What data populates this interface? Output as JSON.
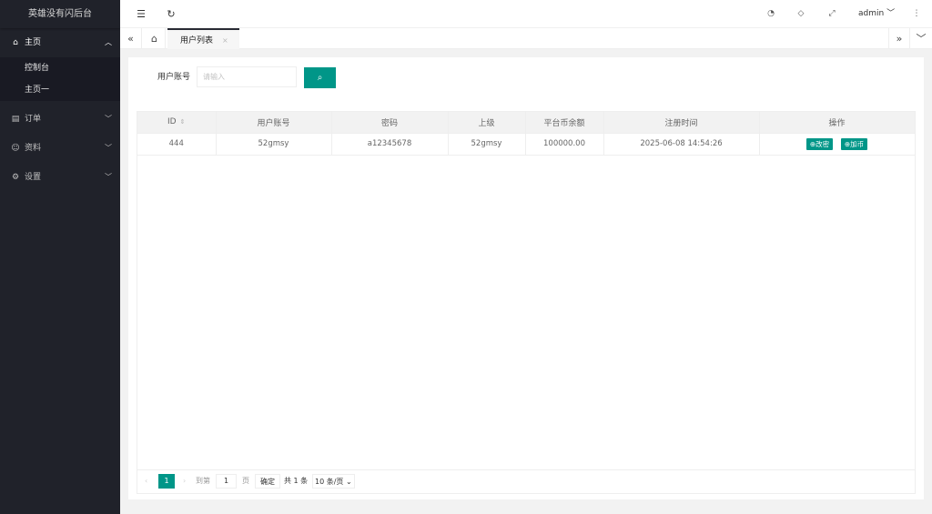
{
  "app": {
    "title": "英雄没有闪后台"
  },
  "sidebar": {
    "home": {
      "label": "主页",
      "icon": "home-icon"
    },
    "home_items": [
      {
        "label": "控制台"
      },
      {
        "label": "主页一"
      }
    ],
    "orders": {
      "label": "订单"
    },
    "profile": {
      "label": "资料"
    },
    "settings": {
      "label": "设置"
    }
  },
  "header": {
    "user": "admin"
  },
  "tabs": {
    "active": {
      "label": "用户列表",
      "close": "×"
    }
  },
  "filter": {
    "label": "用户账号",
    "placeholder": "请输入"
  },
  "table": {
    "columns": [
      "ID",
      "用户账号",
      "密码",
      "上级",
      "平台币余额",
      "注册时间",
      "操作"
    ],
    "rows": [
      {
        "id": "444",
        "account": "52gmsy",
        "password": "a12345678",
        "parent": "52gmsy",
        "balance": "100000.00",
        "registered": "2025-06-08 14:54:26",
        "actions": [
          "改密",
          "加币"
        ]
      }
    ]
  },
  "pager": {
    "current": "1",
    "goto_label": "到第",
    "goto_value": "1",
    "page_unit": "页",
    "confirm": "确定",
    "total": "共 1 条",
    "page_size": "10 条/页"
  },
  "colors": {
    "accent": "#009688",
    "sidebar_bg": "#20222a"
  }
}
